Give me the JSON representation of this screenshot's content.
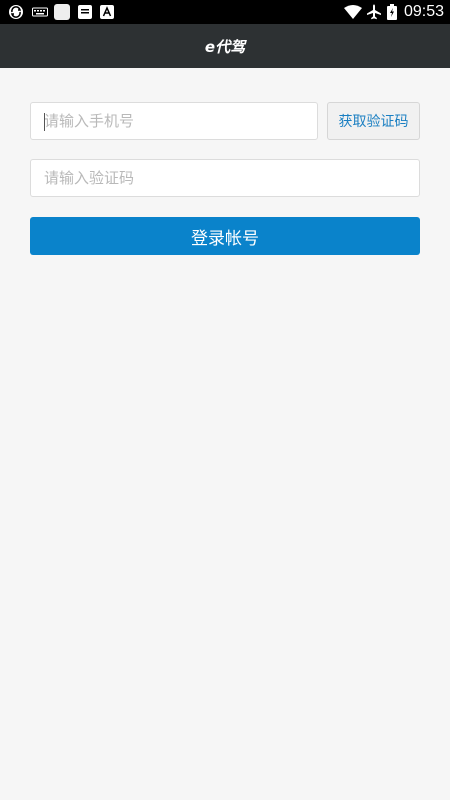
{
  "status_bar": {
    "time": "09:53",
    "left_icons": [
      "sync-icon",
      "keyboard-icon",
      "app-square-icon",
      "message-icon",
      "a-font-icon"
    ],
    "right_icons": [
      "wifi-icon",
      "airplane-icon",
      "battery-icon"
    ]
  },
  "header": {
    "title": "e代驾"
  },
  "form": {
    "phone_placeholder": "请输入手机号",
    "code_button_label": "获取验证码",
    "code_placeholder": "请输入验证码",
    "login_button_label": "登录帐号"
  },
  "colors": {
    "status_bar": "#000000",
    "header": "#2d3133",
    "background": "#f6f6f6",
    "accent": "#0a83cb",
    "code_button_text": "#1a7fc2"
  }
}
